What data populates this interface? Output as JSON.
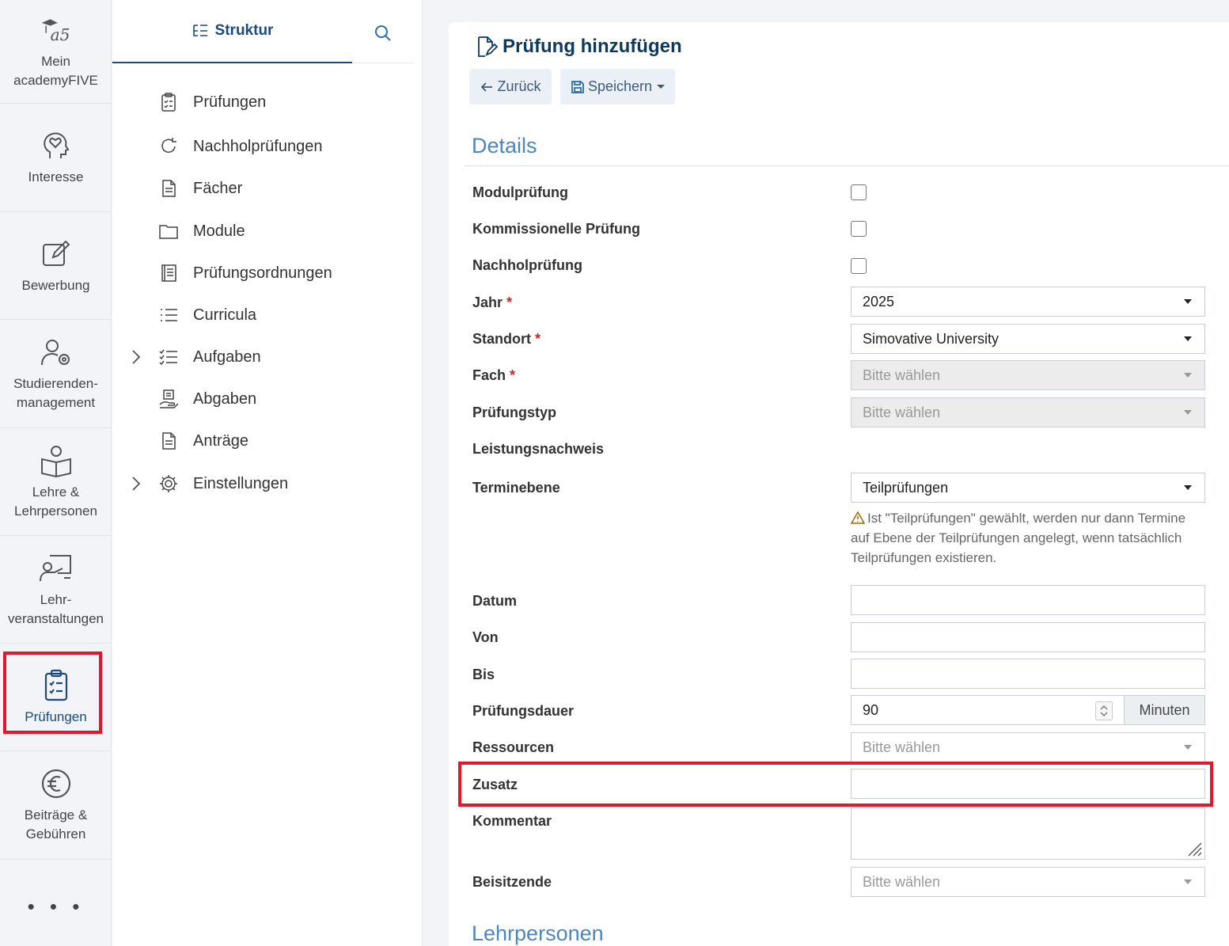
{
  "rail": {
    "items": [
      {
        "label": "Mein\nacademyFIVE",
        "icon": "academyfive-logo-icon"
      },
      {
        "label": "Interesse",
        "icon": "head-heart-icon"
      },
      {
        "label": "Bewerbung",
        "icon": "pencil-square-icon"
      },
      {
        "label": "Studierenden-\nmanagement",
        "icon": "user-gear-icon"
      },
      {
        "label": "Lehre &\nLehrpersonen",
        "icon": "user-book-icon"
      },
      {
        "label": "Lehr-\nveranstaltungen",
        "icon": "presentation-icon"
      },
      {
        "label": "Prüfungen",
        "icon": "clipboard-check-icon"
      },
      {
        "label": "Beiträge &\nGebühren",
        "icon": "euro-circle-icon"
      }
    ],
    "more": "• • •",
    "active_color": "#1c4a7c"
  },
  "struct": {
    "tab_label": "Struktur",
    "items": [
      {
        "label": "Prüfungen"
      },
      {
        "label": "Nachholprüfungen"
      },
      {
        "label": "Fächer"
      },
      {
        "label": "Module"
      },
      {
        "label": "Prüfungsordnungen"
      },
      {
        "label": "Curricula"
      },
      {
        "label": "Aufgaben"
      },
      {
        "label": "Abgaben"
      },
      {
        "label": "Anträge"
      },
      {
        "label": "Einstellungen"
      }
    ]
  },
  "page": {
    "title": "Prüfung hinzufügen",
    "back_label": "Zurück",
    "save_label": "Speichern",
    "section_details": "Details",
    "section_teachers": "Lehrpersonen",
    "required_mark": "*"
  },
  "form": {
    "modulpruefung": "Modulprüfung",
    "kommissionell": "Kommissionelle Prüfung",
    "nachholpruefung": "Nachholprüfung",
    "jahr_label": "Jahr",
    "jahr_value": "2025",
    "standort_label": "Standort",
    "standort_value": "Simovative University",
    "fach_label": "Fach",
    "fach_value": "Bitte wählen",
    "typ_label": "Prüfungstyp",
    "typ_value": "Bitte wählen",
    "leistungsnachweis_label": "Leistungsnachweis",
    "terminebene_label": "Terminebene",
    "terminebene_value": "Teilprüfungen",
    "terminebene_note": "Ist \"Teilprüfungen\" gewählt, werden nur dann Termine auf Ebene der Teilprüfungen angelegt, wenn tatsächlich Teilprüfungen existieren.",
    "datum_label": "Datum",
    "von_label": "Von",
    "bis_label": "Bis",
    "dauer_label": "Prüfungsdauer",
    "dauer_value": "90",
    "dauer_unit": "Minuten",
    "ressourcen_label": "Ressourcen",
    "ressourcen_value": "Bitte wählen",
    "zusatz_label": "Zusatz",
    "kommentar_label": "Kommentar",
    "beisitzende_label": "Beisitzende",
    "beisitzende_value": "Bitte wählen"
  },
  "colors": {
    "highlight": "#e0182d",
    "accent": "#1c4a7c",
    "section": "#4d86bd"
  }
}
